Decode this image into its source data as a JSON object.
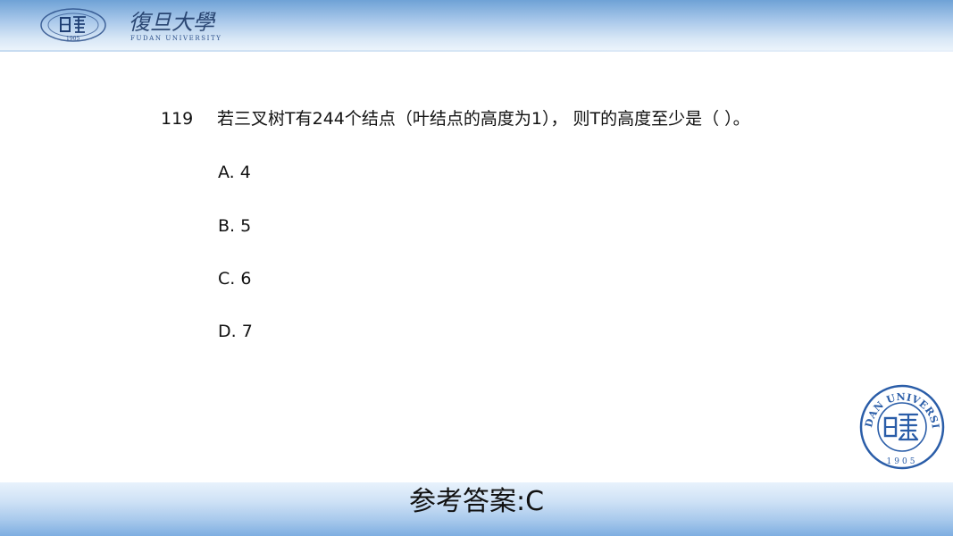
{
  "header": {
    "logo_icon": "fudan-emblem-icon",
    "university_calligraphy": "復旦大學",
    "university_english": "FUDAN UNIVERSITY",
    "logo_year": "1905"
  },
  "question": {
    "number": "119",
    "stem": "若三叉树T有244个结点（叶结点的高度为1），  则T的高度至少是（ ）。",
    "options": [
      "A. 4",
      "B. 5",
      "C. 6",
      "D. 7"
    ]
  },
  "seal": {
    "text": "FUDAN UNIVERSITY",
    "year": "1905",
    "icon": "fudan-seal-icon"
  },
  "footer": {
    "answer": "参考答案:C"
  },
  "colors": {
    "band_blue": "#7eaee1",
    "seal_blue": "#2a5da8",
    "text": "#111111"
  }
}
